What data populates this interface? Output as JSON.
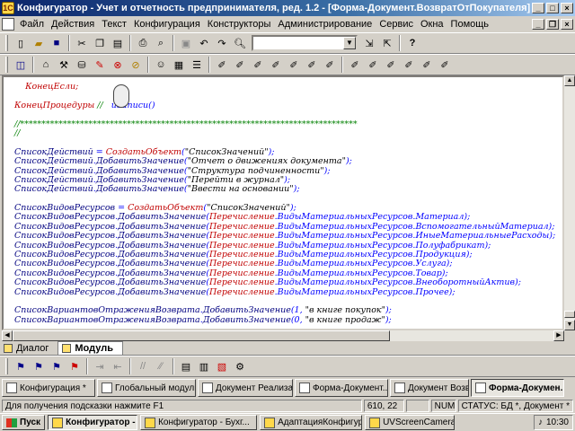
{
  "window": {
    "title": "Конфигуратор - Учет и отчетность предпринимателя, ред. 1.2 - [Форма-Документ.ВозвратОтПокупателя]"
  },
  "menu": [
    "Файл",
    "Действия",
    "Текст",
    "Конфигурация",
    "Конструкторы",
    "Администрирование",
    "Сервис",
    "Окна",
    "Помощь"
  ],
  "toolbar1": {
    "search_value": ""
  },
  "editor": {
    "lines": [
      {
        "indent": "    ",
        "tokens": [
          {
            "c": "k",
            "t": "КонецЕсли;"
          }
        ]
      },
      {
        "indent": "",
        "tokens": []
      },
      {
        "indent": "",
        "tokens": [
          {
            "c": "k",
            "t": "КонецПроцедуры"
          },
          {
            "c": "g",
            "t": " // "
          },
          {
            "c": "b",
            "t": "  иЗаписи()"
          }
        ]
      },
      {
        "indent": "",
        "tokens": []
      },
      {
        "indent": "",
        "tokens": [
          {
            "c": "g",
            "t": "//*******************************************************************************"
          }
        ]
      },
      {
        "indent": "",
        "tokens": [
          {
            "c": "g",
            "t": "//"
          }
        ]
      },
      {
        "indent": "",
        "tokens": []
      },
      {
        "indent": "",
        "tokens": [
          {
            "c": "n",
            "t": "СписокДействий"
          },
          {
            "c": "b",
            "t": " = "
          },
          {
            "c": "k",
            "t": "СоздатьОбъект"
          },
          {
            "c": "b",
            "t": "("
          },
          {
            "c": "x",
            "t": "\"СписокЗначений\""
          },
          {
            "c": "b",
            "t": ");"
          }
        ]
      },
      {
        "indent": "",
        "tokens": [
          {
            "c": "n",
            "t": "СписокДействий"
          },
          {
            "c": "b",
            "t": "."
          },
          {
            "c": "n",
            "t": "ДобавитьЗначение"
          },
          {
            "c": "b",
            "t": "("
          },
          {
            "c": "x",
            "t": "\"Отчет о движениях документа\""
          },
          {
            "c": "b",
            "t": ");"
          }
        ]
      },
      {
        "indent": "",
        "tokens": [
          {
            "c": "n",
            "t": "СписокДействий"
          },
          {
            "c": "b",
            "t": "."
          },
          {
            "c": "n",
            "t": "ДобавитьЗначение"
          },
          {
            "c": "b",
            "t": "("
          },
          {
            "c": "x",
            "t": "\"Структура подчиненности\""
          },
          {
            "c": "b",
            "t": ");"
          }
        ]
      },
      {
        "indent": "",
        "tokens": [
          {
            "c": "n",
            "t": "СписокДействий"
          },
          {
            "c": "b",
            "t": "."
          },
          {
            "c": "n",
            "t": "ДобавитьЗначение"
          },
          {
            "c": "b",
            "t": "("
          },
          {
            "c": "x",
            "t": "\"Перейти в журнал\""
          },
          {
            "c": "b",
            "t": ");"
          }
        ]
      },
      {
        "indent": "",
        "tokens": [
          {
            "c": "n",
            "t": "СписокДействий"
          },
          {
            "c": "b",
            "t": "."
          },
          {
            "c": "n",
            "t": "ДобавитьЗначение"
          },
          {
            "c": "b",
            "t": "("
          },
          {
            "c": "x",
            "t": "\"Ввести на основании\""
          },
          {
            "c": "b",
            "t": ");"
          }
        ]
      },
      {
        "indent": "",
        "tokens": []
      },
      {
        "indent": "",
        "tokens": [
          {
            "c": "n",
            "t": "СписокВидовРесурсов"
          },
          {
            "c": "b",
            "t": " = "
          },
          {
            "c": "k",
            "t": "СоздатьОбъект"
          },
          {
            "c": "b",
            "t": "("
          },
          {
            "c": "x",
            "t": "\"СписокЗначений\""
          },
          {
            "c": "b",
            "t": ");"
          }
        ]
      },
      {
        "indent": "",
        "tokens": [
          {
            "c": "n",
            "t": "СписокВидовРесурсов"
          },
          {
            "c": "b",
            "t": "."
          },
          {
            "c": "n",
            "t": "ДобавитьЗначение"
          },
          {
            "c": "b",
            "t": "("
          },
          {
            "c": "k",
            "t": "Перечисление"
          },
          {
            "c": "b",
            "t": ".ВидыМатериальныхРесурсов.Материал);"
          }
        ]
      },
      {
        "indent": "",
        "tokens": [
          {
            "c": "n",
            "t": "СписокВидовРесурсов"
          },
          {
            "c": "b",
            "t": "."
          },
          {
            "c": "n",
            "t": "ДобавитьЗначение"
          },
          {
            "c": "b",
            "t": "("
          },
          {
            "c": "k",
            "t": "Перечисление"
          },
          {
            "c": "b",
            "t": ".ВидыМатериальныхРесурсов.ВспомогательныйМатериал);"
          }
        ]
      },
      {
        "indent": "",
        "tokens": [
          {
            "c": "n",
            "t": "СписокВидовРесурсов"
          },
          {
            "c": "b",
            "t": "."
          },
          {
            "c": "n",
            "t": "ДобавитьЗначение"
          },
          {
            "c": "b",
            "t": "("
          },
          {
            "c": "k",
            "t": "Перечисление"
          },
          {
            "c": "b",
            "t": ".ВидыМатериальныхРесурсов.ИныеМатериальныеРасходы);"
          }
        ]
      },
      {
        "indent": "",
        "tokens": [
          {
            "c": "n",
            "t": "СписокВидовРесурсов"
          },
          {
            "c": "b",
            "t": "."
          },
          {
            "c": "n",
            "t": "ДобавитьЗначение"
          },
          {
            "c": "b",
            "t": "("
          },
          {
            "c": "k",
            "t": "Перечисление"
          },
          {
            "c": "b",
            "t": ".ВидыМатериальныхРесурсов.Полуфабрикат);"
          }
        ]
      },
      {
        "indent": "",
        "tokens": [
          {
            "c": "n",
            "t": "СписокВидовРесурсов"
          },
          {
            "c": "b",
            "t": "."
          },
          {
            "c": "n",
            "t": "ДобавитьЗначение"
          },
          {
            "c": "b",
            "t": "("
          },
          {
            "c": "k",
            "t": "Перечисление"
          },
          {
            "c": "b",
            "t": ".ВидыМатериальныхРесурсов.Продукция);"
          }
        ]
      },
      {
        "indent": "",
        "tokens": [
          {
            "c": "n",
            "t": "СписокВидовРесурсов"
          },
          {
            "c": "b",
            "t": "."
          },
          {
            "c": "n",
            "t": "ДобавитьЗначение"
          },
          {
            "c": "b",
            "t": "("
          },
          {
            "c": "k",
            "t": "Перечисление"
          },
          {
            "c": "b",
            "t": ".ВидыМатериальныхРесурсов.Услуга);"
          }
        ]
      },
      {
        "indent": "",
        "tokens": [
          {
            "c": "n",
            "t": "СписокВидовРесурсов"
          },
          {
            "c": "b",
            "t": "."
          },
          {
            "c": "n",
            "t": "ДобавитьЗначение"
          },
          {
            "c": "b",
            "t": "("
          },
          {
            "c": "k",
            "t": "Перечисление"
          },
          {
            "c": "b",
            "t": ".ВидыМатериальныхРесурсов.Товар);"
          }
        ]
      },
      {
        "indent": "",
        "tokens": [
          {
            "c": "n",
            "t": "СписокВидовРесурсов"
          },
          {
            "c": "b",
            "t": "."
          },
          {
            "c": "n",
            "t": "ДобавитьЗначение"
          },
          {
            "c": "b",
            "t": "("
          },
          {
            "c": "k",
            "t": "Перечисление"
          },
          {
            "c": "b",
            "t": ".ВидыМатериальныхРесурсов.ВнеоборотныйАктив);"
          }
        ]
      },
      {
        "indent": "",
        "tokens": [
          {
            "c": "n",
            "t": "СписокВидовРесурсов"
          },
          {
            "c": "b",
            "t": "."
          },
          {
            "c": "n",
            "t": "ДобавитьЗначение"
          },
          {
            "c": "b",
            "t": "("
          },
          {
            "c": "k",
            "t": "Перечисление"
          },
          {
            "c": "b",
            "t": ".ВидыМатериальныхРесурсов.Прочее);"
          }
        ]
      },
      {
        "indent": "",
        "tokens": []
      },
      {
        "indent": "",
        "tokens": [
          {
            "c": "n",
            "t": "СписокВариантовОтраженияВозврата"
          },
          {
            "c": "b",
            "t": "."
          },
          {
            "c": "n",
            "t": "ДобавитьЗначение"
          },
          {
            "c": "b",
            "t": "(1, "
          },
          {
            "c": "x",
            "t": "\"в книге покупок\""
          },
          {
            "c": "b",
            "t": ");"
          }
        ]
      },
      {
        "indent": "",
        "tokens": [
          {
            "c": "n",
            "t": "СписокВариантовОтраженияВозврата"
          },
          {
            "c": "b",
            "t": "."
          },
          {
            "c": "n",
            "t": "ДобавитьЗначение"
          },
          {
            "c": "b",
            "t": "(0, "
          },
          {
            "c": "x",
            "t": "\"в книге продаж\""
          },
          {
            "c": "b",
            "t": ");"
          }
        ]
      }
    ]
  },
  "tabs": [
    {
      "label": "Диалог",
      "active": false
    },
    {
      "label": "Модуль",
      "active": true
    }
  ],
  "windows": [
    {
      "label": "Конфигурация *",
      "w": 104
    },
    {
      "label": "Глобальный модуль",
      "w": 110
    },
    {
      "label": "Документ Реализа...",
      "w": 106
    },
    {
      "label": "Форма-Документ....",
      "w": 104
    },
    {
      "label": "Документ Возврат...",
      "w": 88
    },
    {
      "label": "Форма-Докумен...",
      "w": 104,
      "active": true
    }
  ],
  "status": {
    "hint": "Для получения подсказки нажмите F1",
    "position": "610, 22",
    "num": "NUM",
    "state": "СТАТУС: БД *, Документ *"
  },
  "taskbar": {
    "start": "Пуск",
    "tasks": [
      {
        "label": "Конфигуратор - Уч...",
        "w": 100,
        "active": true
      },
      {
        "label": "Конфигуратор - Бухг...",
        "w": 130
      },
      {
        "label": "АдаптацияКонфигур...",
        "w": 114
      },
      {
        "label": "UVScreenCamera",
        "w": 100
      }
    ],
    "time": "10:30"
  }
}
